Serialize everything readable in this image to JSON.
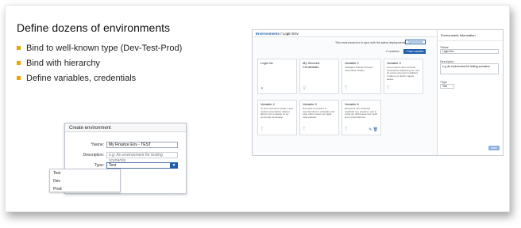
{
  "slide": {
    "title": "Define dozens of environments",
    "bullets": [
      "Bind to well-known type (Dev-Test-Prod)",
      "Bind with hierarchy",
      "Define variables, credentials"
    ],
    "bullet_color": "#f0a500"
  },
  "dialog": {
    "title": "Create environment",
    "name_label": "*Name:",
    "name_value": "My Finance Env - TEST",
    "description_label": "Description:",
    "description_placeholder": "e.g. An environment for testing scenarios",
    "type_label": "Type:",
    "type_value": "Test",
    "type_options": [
      "Test",
      "Dev",
      "Prod"
    ]
  },
  "app": {
    "breadcrumb_root": "Environments",
    "breadcrumb_current": "Login Env",
    "info_text": "This environment is in sync with the active deployments",
    "sync_button": "Synchronize",
    "variables_label": "0 variables",
    "new_variable_button": "+ New variable",
    "tiles": [
      {
        "title": "Login Va",
        "desc": "",
        "icon": "user-icon"
      },
      {
        "title": "My Secured Credentials",
        "desc": "",
        "icon": "key-icon"
      },
      {
        "title": "Variable 2",
        "desc": "Intelligent Robotic Process Automation Studio",
        "icon": "text-icon"
      },
      {
        "title": "Variable 3",
        "desc": "Lorem ipsum dolor sit amet, consectetur adipiscing elit, sed do eiusmod tempor incididunt ut labore et dolore magna aliqua.",
        "icon": "text-icon"
      },
      {
        "title": "Variable 4",
        "desc": "Ut enim ad minim veniam, quis nostrud exercitation ullamco laboris nisi ut aliquip ex ea commodo consequat.",
        "icon": "text-icon"
      },
      {
        "title": "Variable 5",
        "desc": "Duis aute irure dolor in reprehenderit in voluptate velit esse cillum dolore eu fugiat nulla pariatur.",
        "icon": "text-icon"
      },
      {
        "title": "Variable 6",
        "desc": "Excepteur sint occaecat cupidatat non proident, sunt in culpa qui officia deserunt mollit anim id est laborum.",
        "icon": "text-icon"
      }
    ],
    "side": {
      "title": "Environment Information",
      "name_label": "*Name",
      "name_value": "Login Env",
      "description_label": "Description",
      "description_value": "e.g. An environment for testing scenarios",
      "type_label": "*Type",
      "type_value": "Test",
      "save_button": "Save"
    }
  }
}
